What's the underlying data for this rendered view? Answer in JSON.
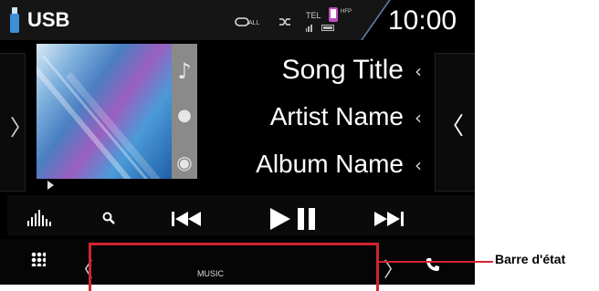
{
  "status_bar": {
    "source": "USB",
    "repeat_label": "ALL",
    "tel_label": "TEL",
    "hfp_label": "HFP",
    "clock": "10:00"
  },
  "track": {
    "song_title": "Song Title",
    "artist_name": "Artist Name",
    "album_name": "Album Name"
  },
  "bottom_bar": {
    "source_label": "MUSIC",
    "callout": "Barre d'état"
  },
  "colors": {
    "highlight": "#d1242f",
    "background": "#000000"
  },
  "icons": [
    "usb-icon",
    "repeat-icon",
    "shuffle-icon",
    "signal-icon",
    "battery-icon",
    "music-note-icon",
    "artist-icon",
    "album-icon",
    "equalizer-icon",
    "search-icon",
    "previous-icon",
    "play-pause-icon",
    "next-icon",
    "menu-grid-icon",
    "phone-icon"
  ]
}
